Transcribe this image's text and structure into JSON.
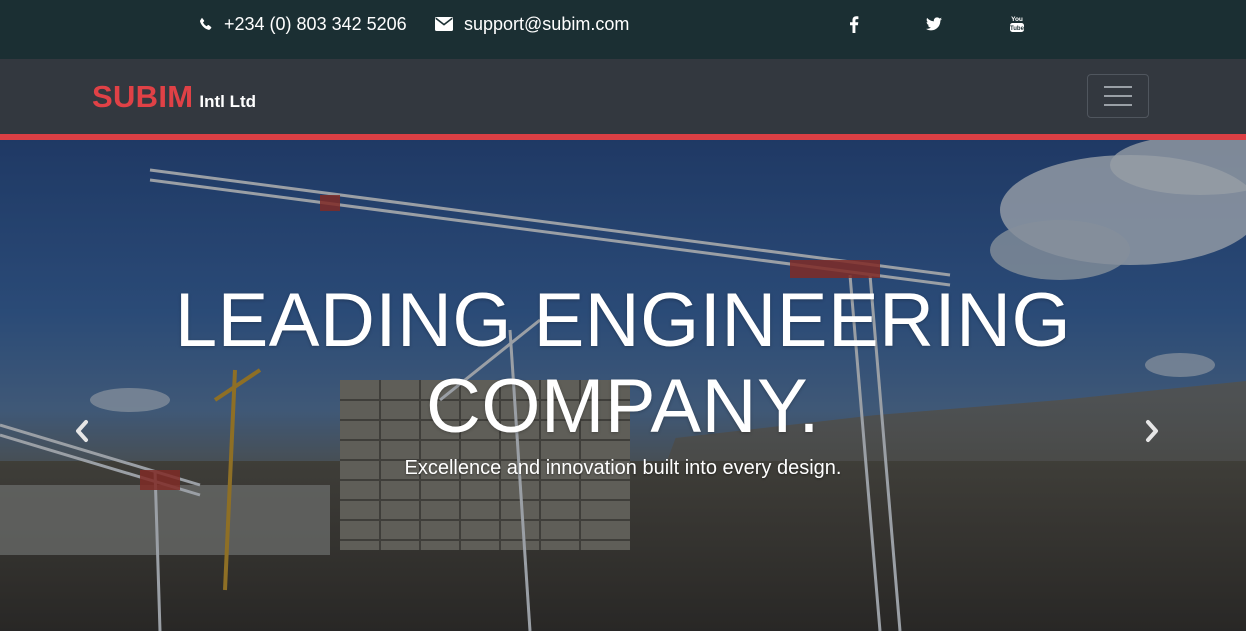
{
  "topbar": {
    "phone_icon": "phone-icon",
    "phone": "+234 (0) 803 342 5206",
    "email_icon": "envelope-icon",
    "email": "support@subim.com",
    "social": [
      {
        "icon": "facebook-icon",
        "label": "f"
      },
      {
        "icon": "twitter-icon"
      },
      {
        "icon": "youtube-icon",
        "label": "You Tube"
      }
    ]
  },
  "navbar": {
    "brand_name": "SUBIM",
    "brand_suffix": "Intl Ltd",
    "toggler_icon": "hamburger-menu-icon"
  },
  "hero": {
    "title_line1": "LEADING ENGINEERING",
    "title_line2": "COMPANY.",
    "subtitle": "Excellence and innovation built into every design.",
    "prev_icon": "chevron-left-icon",
    "next_icon": "chevron-right-icon"
  },
  "colors": {
    "topbar_bg": "#1b2f33",
    "navbar_bg": "#33383f",
    "brand_red": "#e04146",
    "accent_rule": "#dc3f44"
  }
}
